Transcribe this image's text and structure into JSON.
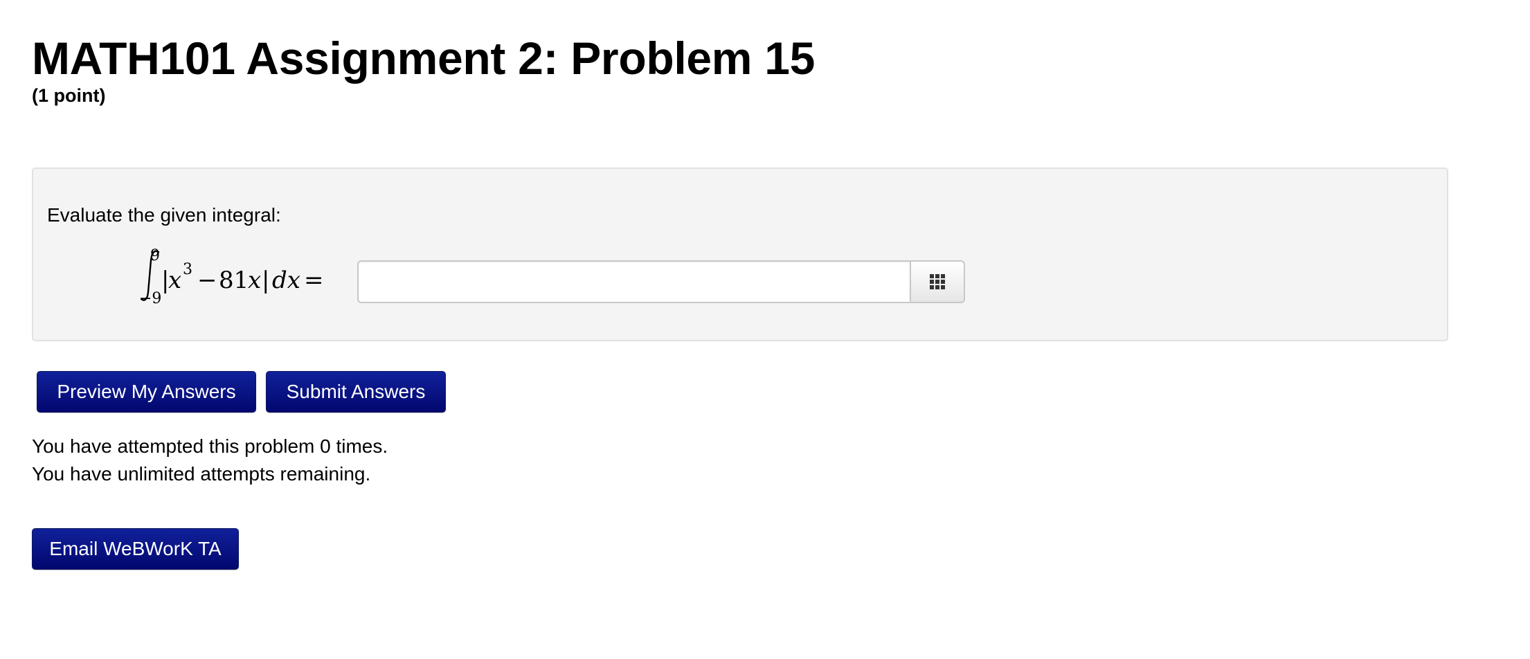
{
  "header": {
    "title": "MATH101 Assignment 2: Problem 15",
    "points": "(1 point)"
  },
  "problem": {
    "prompt": "Evaluate the given integral:",
    "integral": {
      "lower_limit": "−9",
      "upper_limit": "9",
      "integrand_text": "|x³ − 81x| dx =",
      "exponent": "3",
      "coefficient": "81"
    },
    "answer": {
      "value": "",
      "placeholder": ""
    },
    "equation_editor_icon": "grid-icon"
  },
  "actions": {
    "preview_label": "Preview My Answers",
    "submit_label": "Submit Answers",
    "email_label": "Email WeBWorK TA"
  },
  "status": {
    "attempts": "You have attempted this problem 0 times.",
    "remaining": "You have unlimited attempts remaining."
  },
  "colors": {
    "button_background": "#0a157f",
    "problem_background": "#f4f4f4",
    "problem_border": "#e1e1e1"
  }
}
